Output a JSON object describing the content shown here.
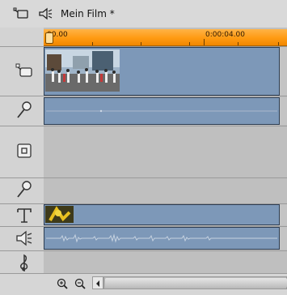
{
  "header": {
    "title": "Mein Film *",
    "video_view_icon": "camera-icon",
    "audio_view_icon": "speaker-icon"
  },
  "ruler": {
    "start_label": "00.00",
    "mark_label": "0:00:04.00",
    "accent_color": "#ff9a12"
  },
  "tracks": [
    {
      "name": "video",
      "icon": "camera-icon"
    },
    {
      "name": "video-overlay",
      "icon": "microphone-icon"
    },
    {
      "name": "overlay",
      "icon": "overlay-frame-icon"
    },
    {
      "name": "overlay-audio",
      "icon": "microphone-icon"
    },
    {
      "name": "title",
      "icon": "title-T-icon"
    },
    {
      "name": "sound-effects",
      "icon": "speaker-icon"
    },
    {
      "name": "music",
      "icon": "treble-clef-icon"
    }
  ],
  "footer": {
    "zoom_in_icon": "zoom-in-icon",
    "zoom_out_icon": "zoom-out-icon",
    "scroll_left_icon": "scroll-left-arrow-icon"
  },
  "colors": {
    "clip_blue": "#7d98b8",
    "ruler_orange": "#ff9a12"
  }
}
